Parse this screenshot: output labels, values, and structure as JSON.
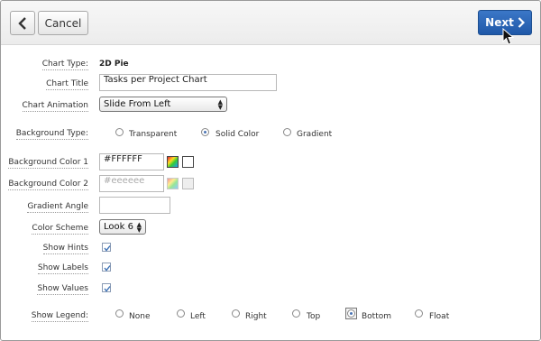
{
  "toolbar": {
    "cancel_label": "Cancel",
    "next_label": "Next"
  },
  "form": {
    "chart_type": {
      "label": "Chart Type:",
      "value": "2D Pie"
    },
    "chart_title": {
      "label": "Chart Title",
      "value": "Tasks per Project Chart"
    },
    "chart_animation": {
      "label": "Chart Animation",
      "value": "Slide From Left"
    },
    "background_type": {
      "label": "Background Type:",
      "options": [
        "Transparent",
        "Solid Color",
        "Gradient"
      ],
      "selected": "Solid Color"
    },
    "background_color_1": {
      "label": "Background Color 1",
      "value": "#FFFFFF"
    },
    "background_color_2": {
      "label": "Background Color 2",
      "placeholder": "#eeeeee"
    },
    "gradient_angle": {
      "label": "Gradient Angle",
      "value": ""
    },
    "color_scheme": {
      "label": "Color Scheme",
      "value": "Look 6"
    },
    "show_hints": {
      "label": "Show Hints",
      "checked": true
    },
    "show_labels": {
      "label": "Show Labels",
      "checked": true
    },
    "show_values": {
      "label": "Show Values",
      "checked": true
    },
    "show_legend": {
      "label": "Show Legend:",
      "options": [
        "None",
        "Left",
        "Right",
        "Top",
        "Bottom",
        "Float"
      ],
      "selected": "Bottom"
    }
  },
  "colors": {
    "accent": "#2a62b0",
    "swatch_color_1": "#FFFFFF",
    "swatch_color_2": "#eeeeee"
  },
  "icons": {
    "back": "chevron-left-icon",
    "next": "chevron-right-icon",
    "picker": "color-picker-icon",
    "check": "checkmark-icon"
  }
}
